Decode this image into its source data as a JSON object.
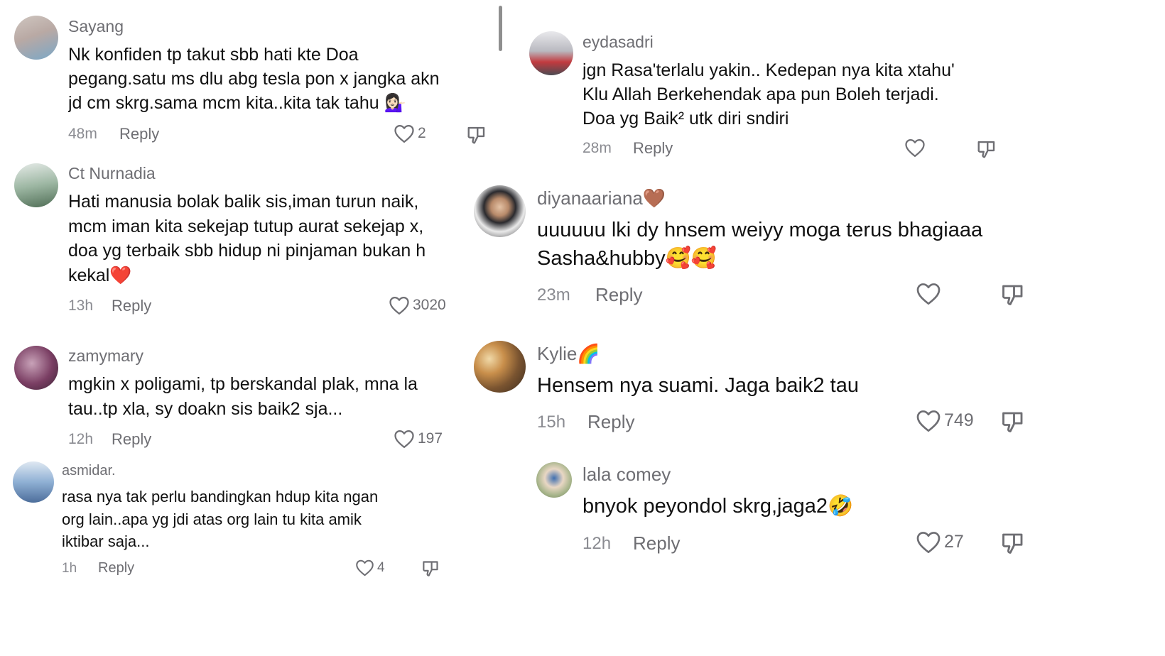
{
  "left_comments": [
    {
      "username": "Sayang",
      "lines": [
        "Nk konfiden tp takut sbb hati kte Doa",
        "pegang.satu ms dlu abg tesla pon x jangka akn",
        "jd cm skrg.sama mcm kita..kita tak tahu 💁🏻‍♀️"
      ],
      "time": "48m",
      "reply": "Reply",
      "likes": "2"
    },
    {
      "username": "Ct Nurnadia",
      "lines": [
        "Hati manusia bolak balik sis,iman turun naik,",
        "mcm iman kita sekejap tutup aurat sekejap x,",
        "doa yg terbaik sbb hidup ni pinjaman bukan h",
        "kekal❤️"
      ],
      "time": "13h",
      "reply": "Reply",
      "likes": "3020"
    },
    {
      "username": "zamymary",
      "lines": [
        "mgkin x poligami, tp berskandal plak, mna la",
        "tau..tp xla, sy doakn sis baik2 sja..."
      ],
      "time": "12h",
      "reply": "Reply",
      "likes": "197"
    },
    {
      "username": "asmidar.",
      "lines": [
        "rasa nya tak perlu bandingkan hdup kita ngan",
        "org lain..apa yg jdi atas org lain tu kita amik",
        "iktibar saja..."
      ],
      "time": "1h",
      "reply": "Reply",
      "likes": "4"
    }
  ],
  "right_comments": [
    {
      "username": "eydasadri",
      "lines": [
        "jgn Rasa'terlalu yakin.. Kedepan nya kita xtahu'",
        "Klu Allah Berkehendak apa pun Boleh terjadi.",
        "Doa yg Baik² utk diri sndiri"
      ],
      "time": "28m",
      "reply": "Reply",
      "likes": ""
    },
    {
      "username": "diyanaariana🤎",
      "lines": [
        "uuuuuu lki dy hnsem weiyy moga terus bhagiaaa",
        "Sasha&hubby🥰🥰"
      ],
      "time": "23m",
      "reply": "Reply",
      "likes": ""
    },
    {
      "username": "Kylie🌈",
      "lines": [
        "Hensem nya suami. Jaga baik2 tau"
      ],
      "time": "15h",
      "reply": "Reply",
      "likes": "749"
    },
    {
      "username": "lala comey",
      "lines": [
        "bnyok peyondol skrg,jaga2🤣"
      ],
      "time": "12h",
      "reply": "Reply",
      "likes": "27"
    }
  ],
  "icons": {
    "like": "heart-outline-icon",
    "dislike": "thumbs-down-icon"
  },
  "colors": {
    "username": "#6e6e73",
    "text": "#111111",
    "meta": "#8a8b91",
    "icon": "#6e6e73"
  }
}
